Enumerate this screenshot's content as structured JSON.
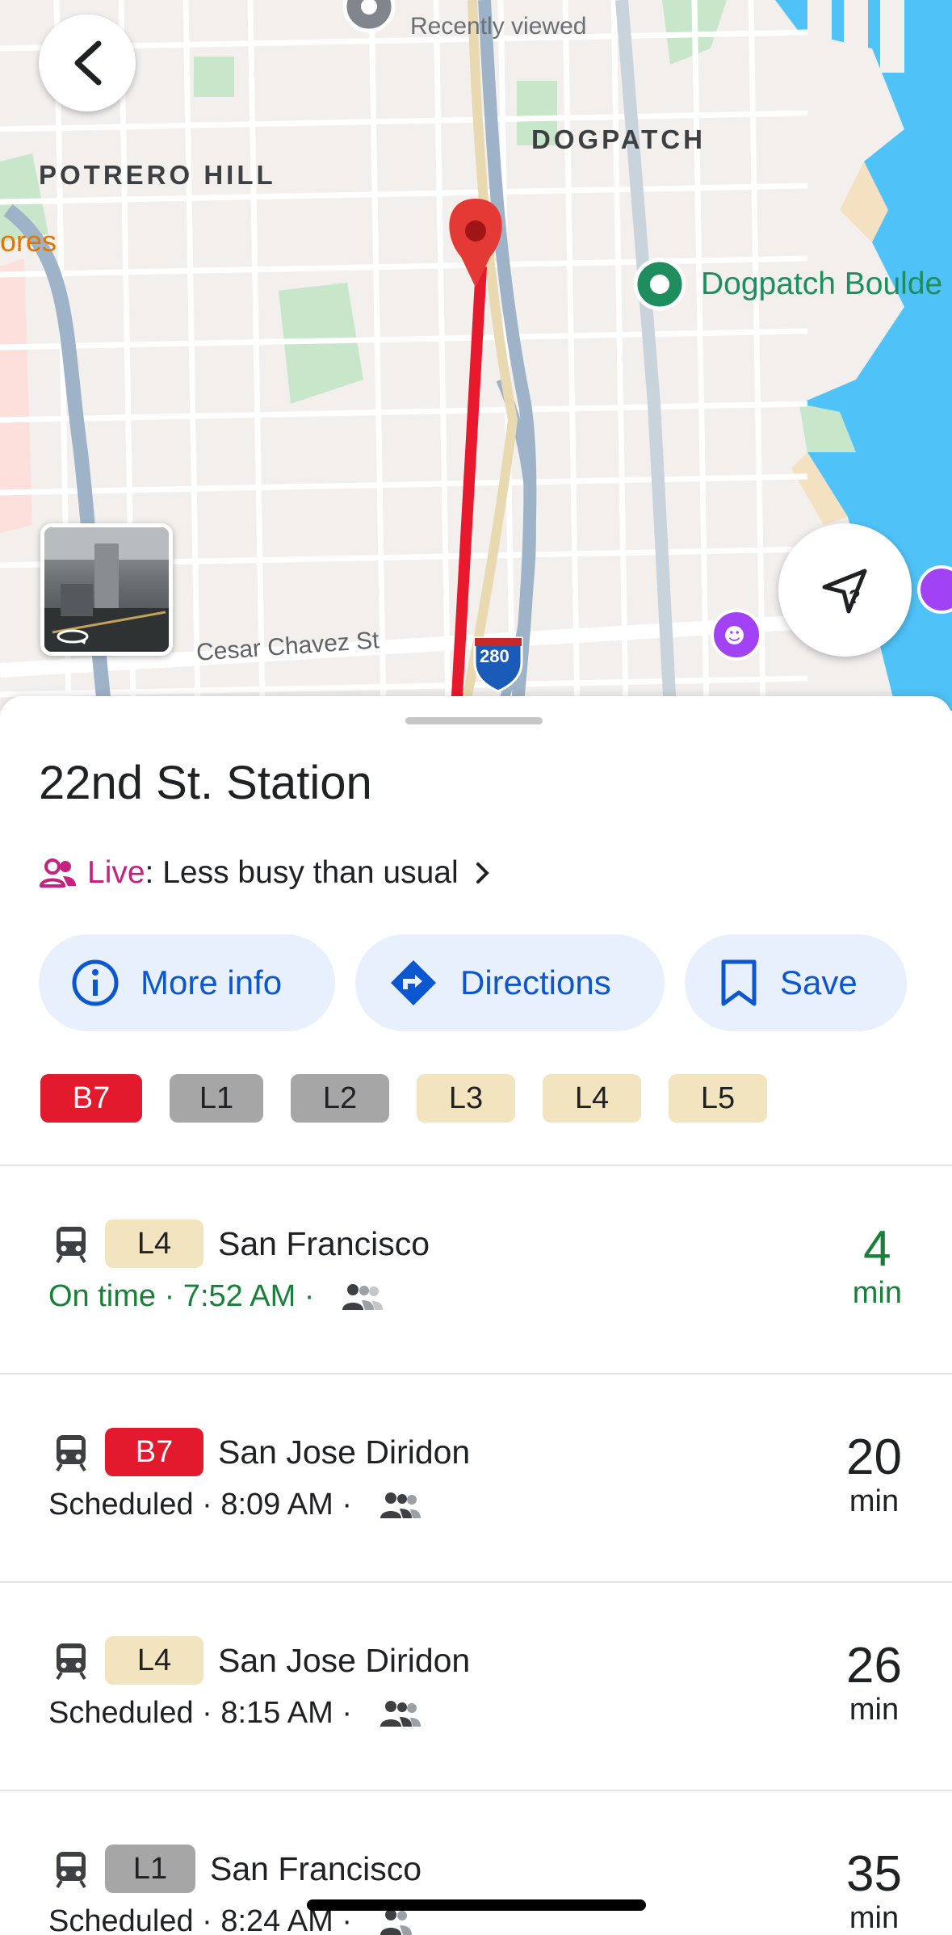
{
  "map": {
    "labels": {
      "recently_viewed": "Recently viewed",
      "neighborhood_potrero": "POTRERO HILL",
      "neighborhood_dogpatch": "DOGPATCH",
      "poi_dogpatch": "Dogpatch Boulde",
      "partial_orange": "ores",
      "street_cesar": "Cesar Chavez St",
      "highway_shield": "280"
    },
    "icons": {
      "back": "arrow-back-icon",
      "street_view": "street-view-thumbnail",
      "locate": "location-question-icon"
    },
    "colors": {
      "route_red": "#e8192c",
      "water": "#4fc3f7",
      "park": "#c8e6c9"
    }
  },
  "station": {
    "title": "22nd St. Station",
    "live_word": "Live",
    "live_text": ": Less busy than usual"
  },
  "actions": [
    {
      "label": "More info",
      "icon": "info-icon"
    },
    {
      "label": "Directions",
      "icon": "directions-icon"
    },
    {
      "label": "Save",
      "icon": "bookmark-icon"
    }
  ],
  "lines": [
    {
      "label": "B7",
      "bg": "#e3192d",
      "fg": "#ffffff"
    },
    {
      "label": "L1",
      "bg": "#a6a6a6",
      "fg": "#202124"
    },
    {
      "label": "L2",
      "bg": "#a6a6a6",
      "fg": "#202124"
    },
    {
      "label": "L3",
      "bg": "#f3e4c0",
      "fg": "#202124"
    },
    {
      "label": "L4",
      "bg": "#f3e4c0",
      "fg": "#202124"
    },
    {
      "label": "L5",
      "bg": "#f3e4c0",
      "fg": "#202124"
    }
  ],
  "departures": [
    {
      "line": "L4",
      "destination": "San Francisco",
      "status": "On time · 7:52 AM ·",
      "minutes": "4",
      "unit": "min",
      "on_time": true
    },
    {
      "line": "B7",
      "destination": "San Jose Diridon",
      "status": "Scheduled · 8:09 AM ·",
      "minutes": "20",
      "unit": "min",
      "on_time": false
    },
    {
      "line": "L4",
      "destination": "San Jose Diridon",
      "status": "Scheduled · 8:15 AM ·",
      "minutes": "26",
      "unit": "min",
      "on_time": false
    },
    {
      "line": "L1",
      "destination": "San Francisco",
      "status": "Scheduled · 8:24 AM ·",
      "minutes": "35",
      "unit": "min",
      "on_time": false
    }
  ]
}
